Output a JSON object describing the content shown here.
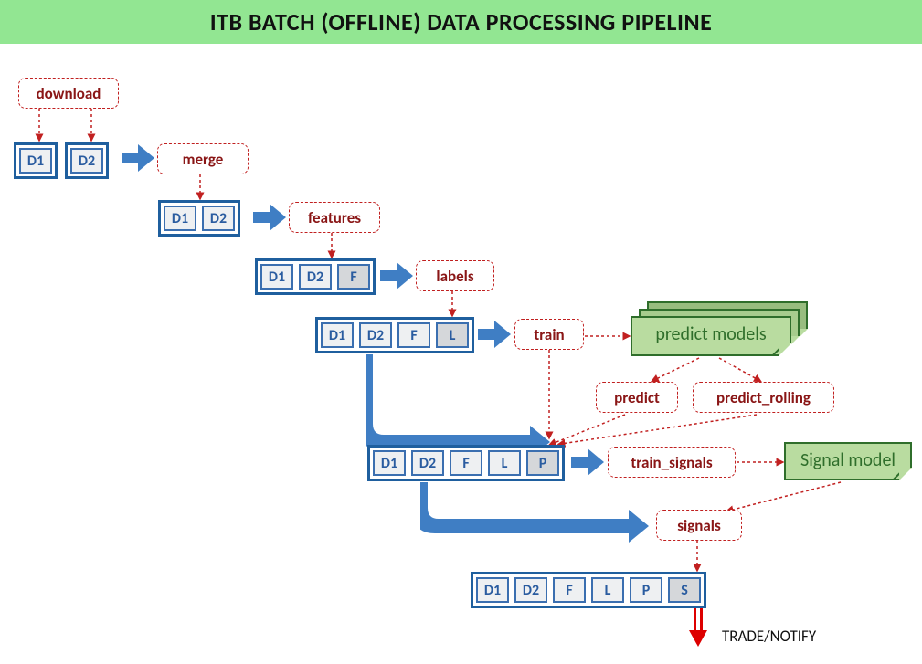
{
  "title": "ITB BATCH (OFFLINE) DATA PROCESSING PIPELINE",
  "steps": {
    "download": "download",
    "merge": "merge",
    "features": "features",
    "labels": "labels",
    "train": "train",
    "predict": "predict",
    "predict_rolling": "predict_rolling",
    "train_signals": "train_signals",
    "signals": "signals"
  },
  "cells_labels": {
    "D1": "D1",
    "D2": "D2",
    "F": "F",
    "L": "L",
    "P": "P",
    "S": "S"
  },
  "models": {
    "predict": "predict models",
    "signal": "Signal model"
  },
  "output_label": "TRADE/NOTIFY",
  "colors": {
    "title_bg": "#92e692",
    "step_border": "#c12020",
    "step_text": "#8a1616",
    "cell_border": "#3b6fb0",
    "cell_text": "#2a5ca0",
    "arrow_blue": "#3f7ec4",
    "model_fill": "#b9dca0",
    "model_border": "#2f6e2b"
  }
}
